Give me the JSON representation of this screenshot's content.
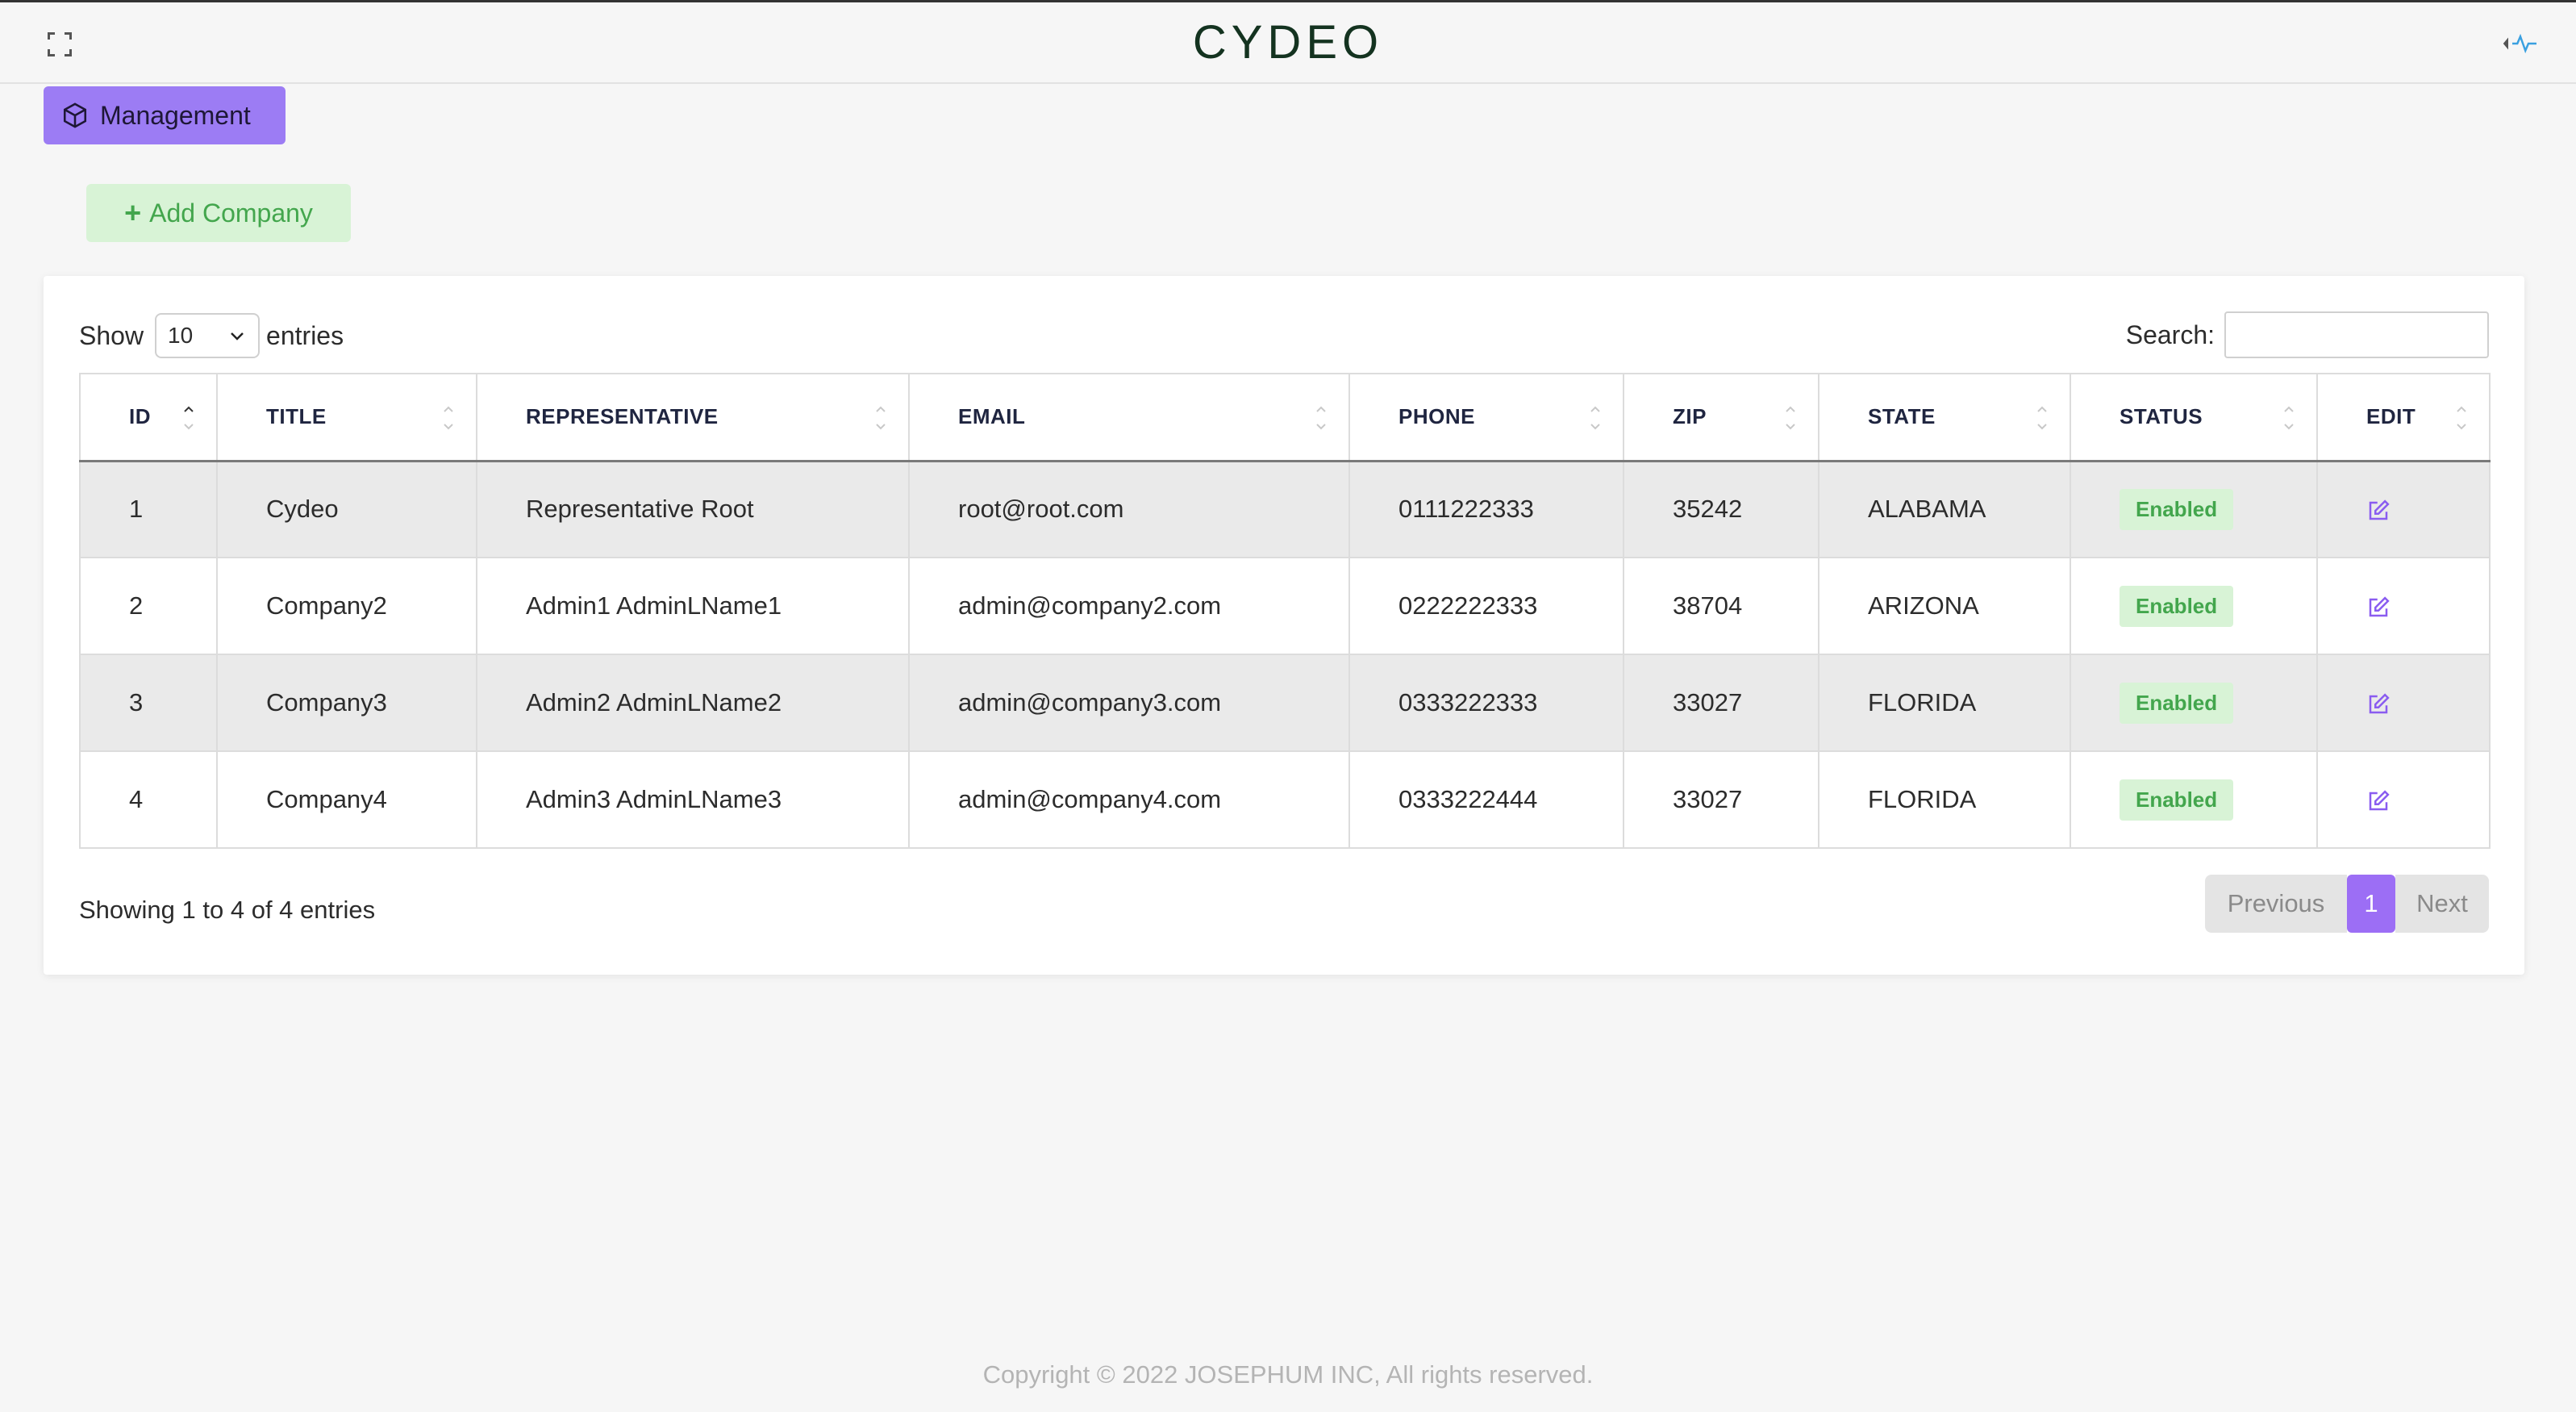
{
  "header": {
    "brand": "CYDEO"
  },
  "nav": {
    "management_label": "Management"
  },
  "actions": {
    "add_company_label": "Add Company"
  },
  "table_controls": {
    "show_label": "Show",
    "entries_label": "entries",
    "page_length": "10",
    "search_label": "Search:",
    "search_value": ""
  },
  "columns": [
    "ID",
    "TITLE",
    "REPRESENTATIVE",
    "EMAIL",
    "PHONE",
    "ZIP",
    "STATE",
    "STATUS",
    "EDIT"
  ],
  "rows": [
    {
      "id": "1",
      "title": "Cydeo",
      "representative": "Representative Root",
      "email": "root@root.com",
      "phone": "0111222333",
      "zip": "35242",
      "state": "ALABAMA",
      "status": "Enabled"
    },
    {
      "id": "2",
      "title": "Company2",
      "representative": "Admin1 AdminLName1",
      "email": "admin@company2.com",
      "phone": "0222222333",
      "zip": "38704",
      "state": "ARIZONA",
      "status": "Enabled"
    },
    {
      "id": "3",
      "title": "Company3",
      "representative": "Admin2 AdminLName2",
      "email": "admin@company3.com",
      "phone": "0333222333",
      "zip": "33027",
      "state": "FLORIDA",
      "status": "Enabled"
    },
    {
      "id": "4",
      "title": "Company4",
      "representative": "Admin3 AdminLName3",
      "email": "admin@company4.com",
      "phone": "0333222444",
      "zip": "33027",
      "state": "FLORIDA",
      "status": "Enabled"
    }
  ],
  "table_info": "Showing 1 to 4 of 4 entries",
  "pagination": {
    "previous": "Previous",
    "current": "1",
    "next": "Next"
  },
  "footer": {
    "text": "Copyright © 2022  JOSEPHUM INC, All rights reserved."
  },
  "colors": {
    "accent": "#9c7cf4",
    "success_bg": "#d8f3d6",
    "success_text": "#43a64d",
    "edit_icon": "#8a5cf0"
  }
}
